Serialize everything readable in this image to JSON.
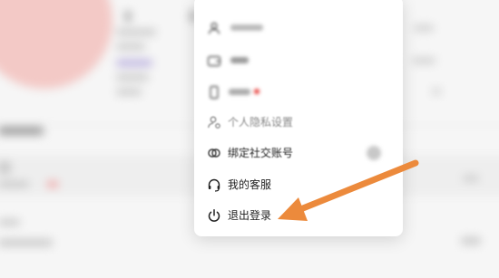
{
  "menu": {
    "items": [
      {
        "id": "item-1",
        "label": "",
        "icon": "user-icon"
      },
      {
        "id": "item-2",
        "label": "",
        "icon": "wallet-icon"
      },
      {
        "id": "item-3",
        "label": "",
        "icon": "phone-icon",
        "badge_color": "#e53935"
      },
      {
        "id": "privacy",
        "label": "个人隐私设置",
        "icon": "privacy-icon"
      },
      {
        "id": "bind-social",
        "label": "绑定社交账号",
        "icon": "link-icon"
      },
      {
        "id": "customer-service",
        "label": "我的客服",
        "icon": "headset-icon"
      },
      {
        "id": "logout",
        "label": "退出登录",
        "icon": "power-icon"
      }
    ]
  },
  "colors": {
    "arrow": "#ec8a3c",
    "menu_background": "#ffffff",
    "badge": "#e53935"
  }
}
